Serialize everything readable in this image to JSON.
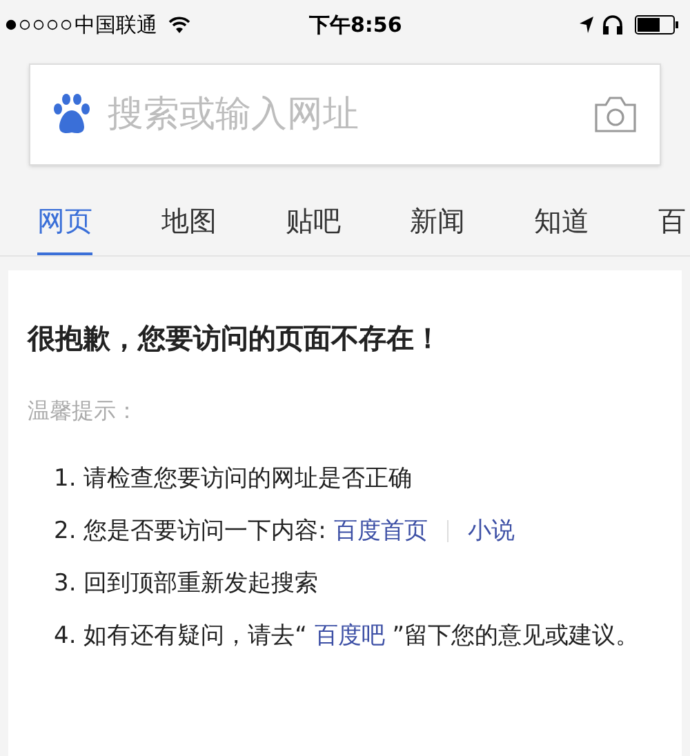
{
  "status_bar": {
    "carrier": "中国联通",
    "time": "下午8:56"
  },
  "search": {
    "placeholder": "搜索或输入网址"
  },
  "tabs": [
    {
      "label": "网页",
      "selected": true
    },
    {
      "label": "地图",
      "selected": false
    },
    {
      "label": "贴吧",
      "selected": false
    },
    {
      "label": "新闻",
      "selected": false
    },
    {
      "label": "知道",
      "selected": false
    },
    {
      "label": "百",
      "selected": false
    }
  ],
  "error": {
    "title": "很抱歉，您要访问的页面不存在！",
    "hint_label": "温馨提示：",
    "tips": [
      {
        "parts": [
          {
            "kind": "text",
            "text": "1. 请检查您要访问的网址是否正确"
          }
        ]
      },
      {
        "parts": [
          {
            "kind": "text",
            "text": "2. 您是否要访问一下内容: "
          },
          {
            "kind": "link",
            "text": "百度首页"
          },
          {
            "kind": "link",
            "text": "小说"
          }
        ]
      },
      {
        "parts": [
          {
            "kind": "text",
            "text": "3. 回到顶部重新发起搜索"
          }
        ]
      },
      {
        "parts": [
          {
            "kind": "text",
            "text": "4. 如有还有疑问，请去“ "
          },
          {
            "kind": "link",
            "text": "百度吧"
          },
          {
            "kind": "text",
            "text": " ”留下您的意见或建议。"
          }
        ]
      }
    ]
  }
}
